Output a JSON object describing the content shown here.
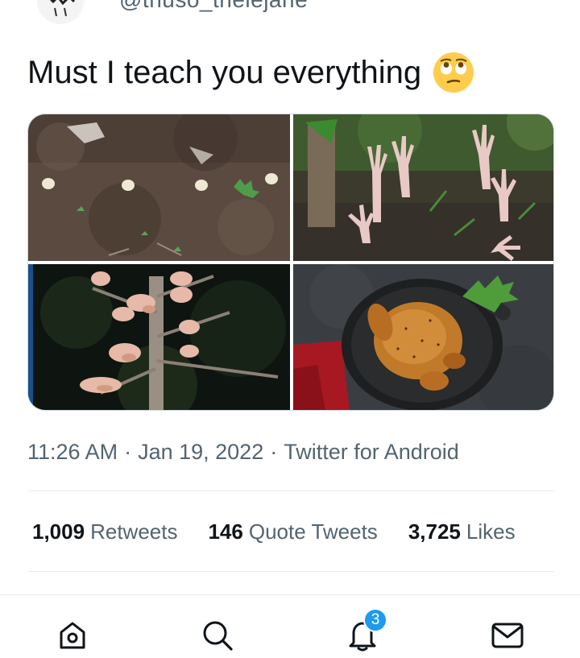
{
  "tweet": {
    "handle": "@thuso_thelejane",
    "text": "Must I teach you everything",
    "emoji": "eye-roll-face",
    "media": [
      {
        "name": "eggs-planted-in-soil"
      },
      {
        "name": "chicken-feet-growing-from-ground"
      },
      {
        "name": "chickens-growing-on-tree"
      },
      {
        "name": "roast-chicken-in-pan"
      }
    ],
    "time": "11:26 AM",
    "date": "Jan 19, 2022",
    "source": "Twitter for Android",
    "separator": "·"
  },
  "stats": {
    "retweets": {
      "count": "1,009",
      "label": "Retweets"
    },
    "quotes": {
      "count": "146",
      "label": "Quote Tweets"
    },
    "likes": {
      "count": "3,725",
      "label": "Likes"
    }
  },
  "nav": {
    "items": [
      {
        "icon": "home-icon"
      },
      {
        "icon": "search-icon"
      },
      {
        "icon": "notifications-icon"
      },
      {
        "icon": "messages-icon"
      }
    ],
    "notification_badge": "3"
  },
  "colors": {
    "accent": "#1d9bf0",
    "text": "#0f1419",
    "secondary": "#536471"
  }
}
